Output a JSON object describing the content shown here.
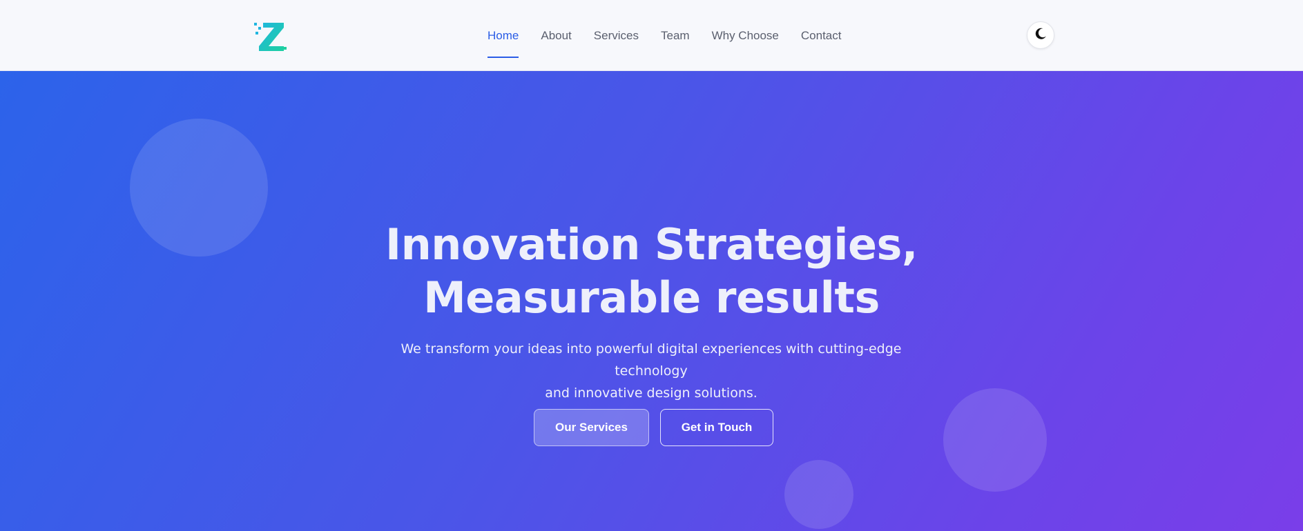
{
  "brand": {
    "logo_icon": "z-logo-icon",
    "accent_from": "#1fb6e0",
    "accent_to": "#1fd0a0"
  },
  "nav": {
    "items": [
      {
        "label": "Home",
        "active": true
      },
      {
        "label": "About"
      },
      {
        "label": "Services"
      },
      {
        "label": "Team"
      },
      {
        "label": "Why Choose"
      },
      {
        "label": "Contact"
      }
    ],
    "theme_toggle_icon": "moon-icon"
  },
  "hero": {
    "title_line1": "Innovation Strategies,",
    "title_line2": "Measurable results",
    "subtitle_line1": "We transform your ideas into powerful digital experiences with cutting-edge technology",
    "subtitle_line2": "and innovative design solutions.",
    "primary_button": "Our Services",
    "secondary_button": "Get in Touch"
  },
  "colors": {
    "accent": "#2a5ce6",
    "gradient_start": "#2c63ea",
    "gradient_end": "#7a3ee9"
  }
}
